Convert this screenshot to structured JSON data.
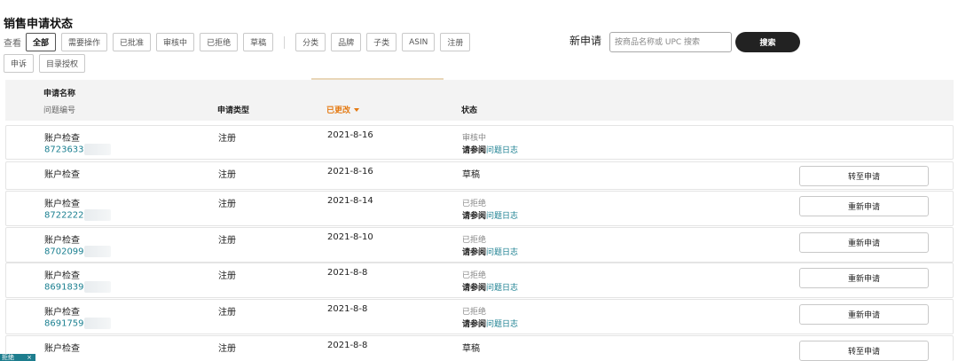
{
  "page_title": "销售申请状态",
  "view_label": "查看",
  "filters_row1": [
    "全部",
    "需要操作",
    "已批准",
    "审核中",
    "已拒绝",
    "草稿"
  ],
  "filters_group2": [
    "分类",
    "品牌",
    "子类",
    "ASIN",
    "注册"
  ],
  "filters_row2": [
    "申诉",
    "目录授权"
  ],
  "new_application": {
    "label": "新申请",
    "search_placeholder": "按商品名称或 UPC 搜索",
    "search_button": "搜索"
  },
  "table": {
    "headers": {
      "name": "申请名称",
      "issue_id": "问题编号",
      "type": "申请类型",
      "modified": "已更改",
      "status": "状态"
    },
    "rows": [
      {
        "name": "账户检查",
        "id": "8723633",
        "type": "注册",
        "date": "2021-8-16",
        "status": "审核中",
        "ref_prefix": "请参阅",
        "ref_link": "问题日志",
        "button": ""
      },
      {
        "name": "账户检查",
        "id": "",
        "type": "注册",
        "date": "2021-8-16",
        "status": "草稿",
        "ref_prefix": "",
        "ref_link": "",
        "button": "转至申请"
      },
      {
        "name": "账户检查",
        "id": "8722222",
        "type": "注册",
        "date": "2021-8-14",
        "status": "已拒绝",
        "ref_prefix": "请参阅",
        "ref_link": "问题日志",
        "button": "重新申请"
      },
      {
        "name": "账户检查",
        "id": "8702099",
        "type": "注册",
        "date": "2021-8-10",
        "status": "已拒绝",
        "ref_prefix": "请参阅",
        "ref_link": "问题日志",
        "button": "重新申请"
      },
      {
        "name": "账户检查",
        "id": "8691839",
        "type": "注册",
        "date": "2021-8-8",
        "status": "已拒绝",
        "ref_prefix": "请参阅",
        "ref_link": "问题日志",
        "button": "重新申请"
      },
      {
        "name": "账户检查",
        "id": "8691759",
        "type": "注册",
        "date": "2021-8-8",
        "status": "已拒绝",
        "ref_prefix": "请参阅",
        "ref_link": "问题日志",
        "button": "重新申请"
      },
      {
        "name": "账户检查",
        "id": "",
        "type": "注册",
        "date": "2021-8-8",
        "status": "草稿",
        "ref_prefix": "",
        "ref_link": "",
        "button": "转至申请"
      }
    ]
  },
  "corner_tag": {
    "label": "拒绝",
    "close": "×"
  },
  "colors": {
    "link": "#1a7f90",
    "sort_accent": "#e47911",
    "button_dark": "#222222"
  }
}
